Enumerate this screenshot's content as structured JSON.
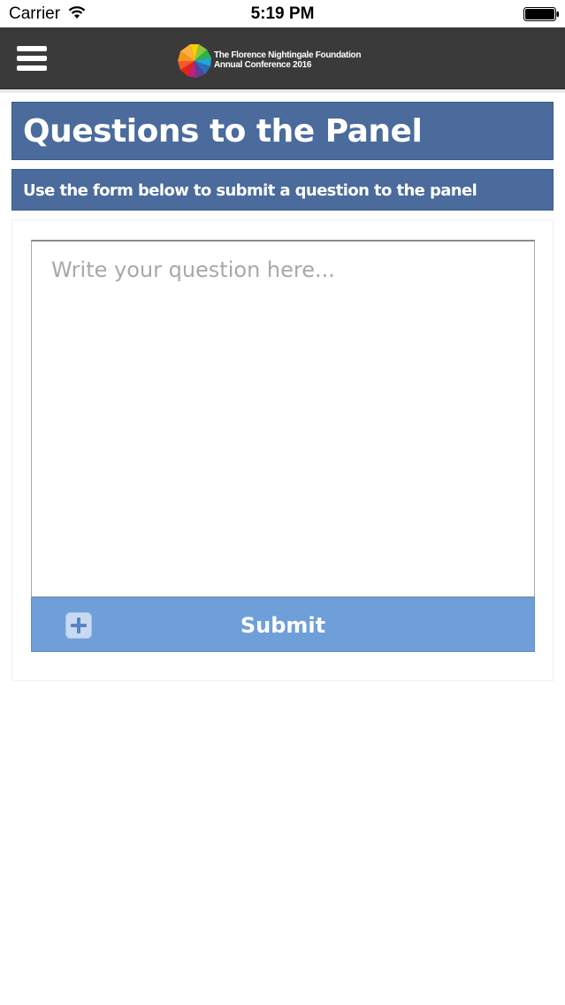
{
  "status_bar": {
    "carrier": "Carrier",
    "time": "5:19 PM",
    "wifi_icon": "wifi-icon",
    "battery_icon": "battery-icon"
  },
  "header": {
    "menu_icon": "hamburger-menu-icon",
    "logo_line1": "The Florence Nightingale Foundation",
    "logo_line2": "Annual Conference 2016",
    "background": "#3a3a3a"
  },
  "page": {
    "title": "Questions to the Panel",
    "subtitle": "Use the form below to submit a question to the panel",
    "banner_color": "#4a6b9b"
  },
  "form": {
    "question_placeholder": "Write your question here...",
    "question_value": "",
    "submit_label": "Submit",
    "submit_icon": "plus-icon",
    "submit_color": "#6f9fd8"
  }
}
